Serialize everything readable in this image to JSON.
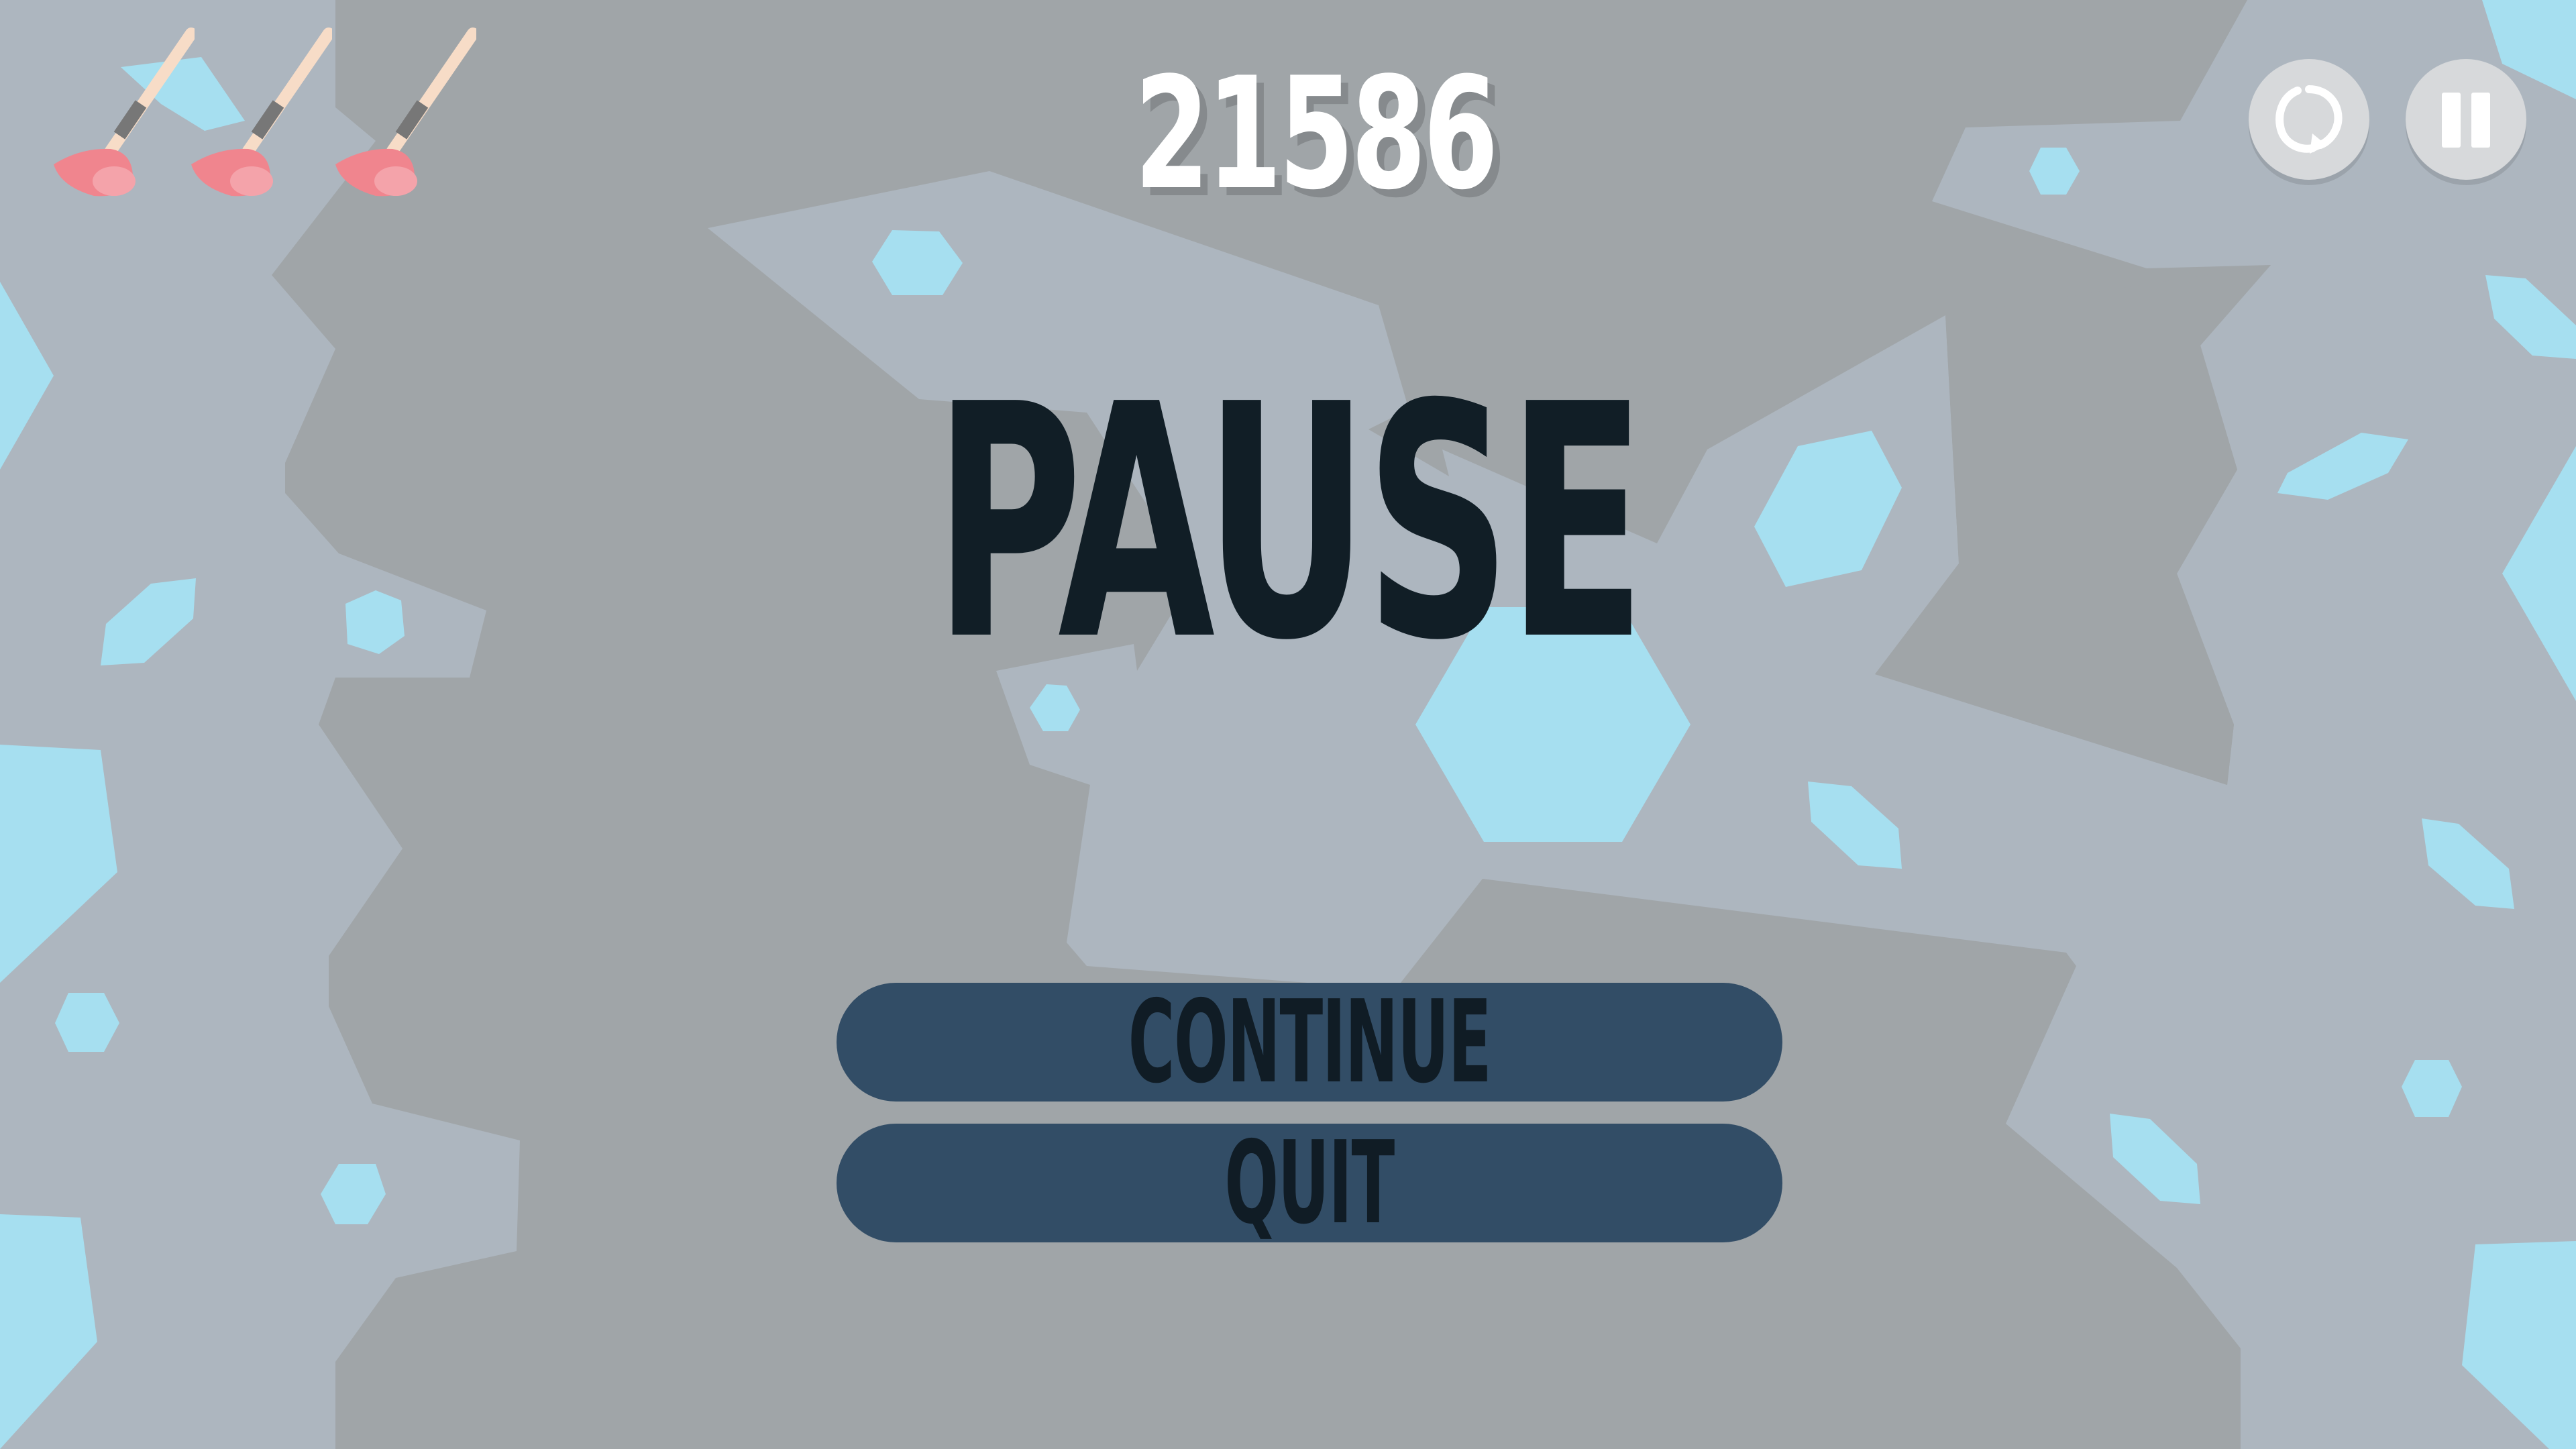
{
  "hud": {
    "score": "21586",
    "lives_icon": "plunger-icon",
    "lives_count": 3,
    "restart_icon": "restart-icon",
    "pause_icon": "pause-icon"
  },
  "pause_menu": {
    "title": "PAUSE",
    "continue_label": "CONTINUE",
    "quit_label": "QUIT"
  },
  "colors": {
    "background_dark": "#a0a5a8",
    "background_light": "#adb6bf",
    "crystal": "#a6dff0",
    "button": "#324d66",
    "title_text": "#111e26",
    "plunger_cup": "#f0858e",
    "plunger_handle": "#f7dcc7"
  }
}
